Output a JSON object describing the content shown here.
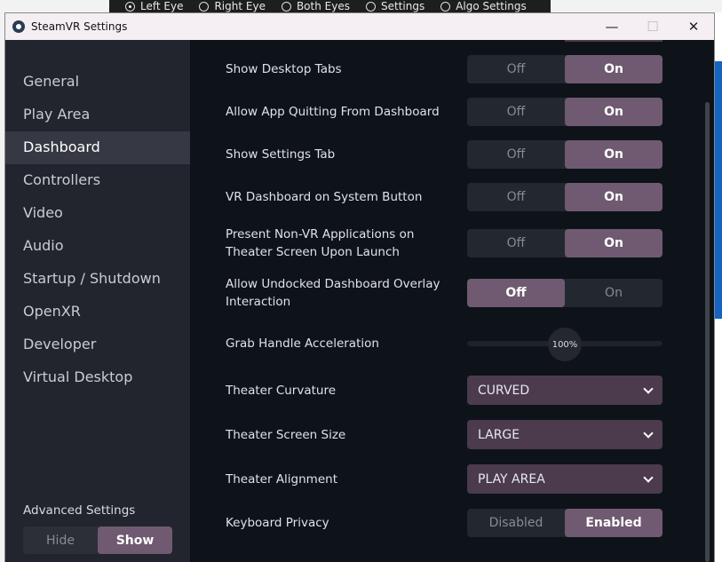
{
  "top_bar": {
    "options": [
      {
        "label": "Left Eye",
        "selected": true
      },
      {
        "label": "Right Eye",
        "selected": false
      },
      {
        "label": "Both Eyes",
        "selected": false
      },
      {
        "label": "Settings",
        "selected": false
      },
      {
        "label": "Algo Settings",
        "selected": false
      }
    ]
  },
  "window": {
    "title": "SteamVR Settings",
    "minimize": "—",
    "maximize": "☐",
    "close": "✕"
  },
  "sidebar": {
    "items": [
      "General",
      "Play Area",
      "Dashboard",
      "Controllers",
      "Video",
      "Audio",
      "Startup / Shutdown",
      "OpenXR",
      "Developer",
      "Virtual Desktop"
    ],
    "active": "Dashboard",
    "advanced": {
      "label": "Advanced Settings",
      "options": [
        "Hide",
        "Show"
      ],
      "selected": "Show"
    }
  },
  "settings": {
    "toggles": [
      {
        "label": "Show Desktop Tabs",
        "off": "Off",
        "on": "On",
        "value": "On"
      },
      {
        "label": "Allow App Quitting From Dashboard",
        "off": "Off",
        "on": "On",
        "value": "On"
      },
      {
        "label": "Show Settings Tab",
        "off": "Off",
        "on": "On",
        "value": "On"
      },
      {
        "label": "VR Dashboard on System Button",
        "off": "Off",
        "on": "On",
        "value": "On"
      },
      {
        "label": "Present Non-VR Applications on Theater Screen Upon Launch",
        "off": "Off",
        "on": "On",
        "value": "On"
      },
      {
        "label": "Allow Undocked Dashboard Overlay Interaction",
        "off": "Off",
        "on": "On",
        "value": "Off"
      }
    ],
    "grab_handle": {
      "label": "Grab Handle Acceleration",
      "value_text": "100%",
      "fraction": 0.5
    },
    "dropdowns": [
      {
        "label": "Theater Curvature",
        "value": "CURVED"
      },
      {
        "label": "Theater Screen Size",
        "value": "LARGE"
      },
      {
        "label": "Theater Alignment",
        "value": "PLAY AREA"
      }
    ],
    "keyboard_privacy": {
      "label": "Keyboard Privacy",
      "off": "Disabled",
      "on": "Enabled",
      "value": "Enabled"
    }
  },
  "colors": {
    "accent": "#6f5a71",
    "dropdown": "#4b3b4d",
    "bg": "#0e131a",
    "sidebar": "#22252d"
  }
}
